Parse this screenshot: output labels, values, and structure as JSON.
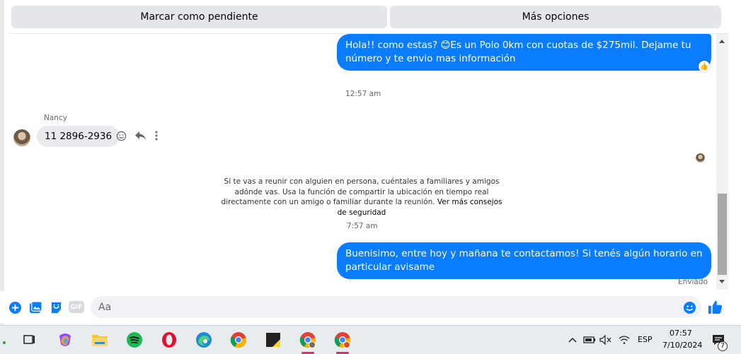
{
  "header": {
    "mark_pending": "Marcar como pendiente",
    "more_options": "Más opciones"
  },
  "messages": {
    "outgoing_1": "Hola!! como estas? 😊Es un Polo 0km con cuotas de $275mil. Dejame tu número y te envio mas información",
    "outgoing_1_reaction": "👍",
    "time_1": "12:57 am",
    "sender_name": "Nancy",
    "incoming_1": "11 2896-2936",
    "safety_text": "Si te vas a reunir con alguien en persona, cuéntales a familiares y amigos adónde vas. Usa la función de compartir la ubicación en tiempo real directamente con un amigo o familiar durante la reunión.",
    "safety_link": "Ver más consejos de seguridad",
    "time_2": "7:57 am",
    "outgoing_2": "Buenisimo, entre hoy y mañana te contactamos! Si tenés algún horario en particular avisame",
    "status": "Enviado"
  },
  "composer": {
    "placeholder": "Aa",
    "gif_label": "GIF"
  },
  "taskbar": {
    "language": "ESP",
    "time": "07:57",
    "date": "7/10/2024",
    "notification_count": "7"
  },
  "colors": {
    "messenger_blue": "#0a7cff",
    "incoming_bubble": "#e9eaee"
  }
}
